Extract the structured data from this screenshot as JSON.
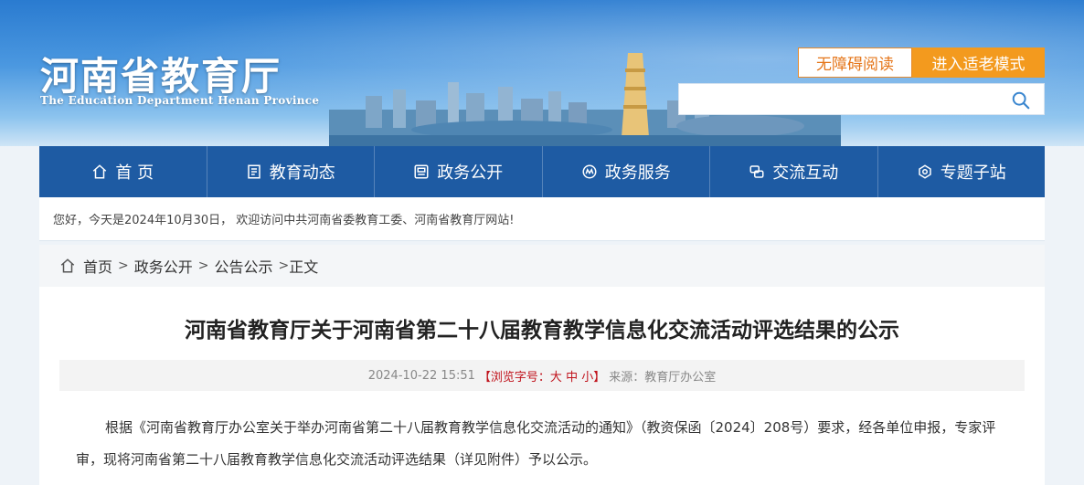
{
  "header": {
    "site_title": "河南省教育厅",
    "site_subtitle": "The Education Department Henan Province",
    "accessibility_label": "无障碍阅读",
    "elder_mode_label": "进入适老模式",
    "search_placeholder": ""
  },
  "nav": {
    "items": [
      {
        "label": "首 页",
        "icon": "home-icon"
      },
      {
        "label": "教育动态",
        "icon": "news-icon"
      },
      {
        "label": "政务公开",
        "icon": "document-icon"
      },
      {
        "label": "政务服务",
        "icon": "service-icon"
      },
      {
        "label": "交流互动",
        "icon": "interaction-icon"
      },
      {
        "label": "专题子站",
        "icon": "topic-icon"
      }
    ]
  },
  "welcome": {
    "text": "您好，今天是2024年10月30日，  欢迎访问中共河南省委教育工委、河南省教育厅网站!"
  },
  "breadcrumb": {
    "items": [
      "首页",
      "政务公开",
      "公告公示",
      "正文"
    ]
  },
  "article": {
    "title": "河南省教育厅关于河南省第二十八届教育教学信息化交流活动评选结果的公示",
    "date": "2024-10-22 15:51",
    "font_size_prefix": "【浏览字号：",
    "font_size_large": "大",
    "font_size_medium": "中",
    "font_size_small": "小",
    "font_size_suffix": "】",
    "source": "来源：教育厅办公室",
    "body": "根据《河南省教育厅办公室关于举办河南省第二十八届教育教学信息化交流活动的通知》（教资保函〔2024〕208号）要求，经各单位申报，专家评审，现将河南省第二十八届教育教学信息化交流活动评选结果（详见附件）予以公示。"
  },
  "colors": {
    "nav_bg": "#1e5ba3",
    "elder_button": "#f39a1e",
    "accent_red": "#c0121b"
  }
}
